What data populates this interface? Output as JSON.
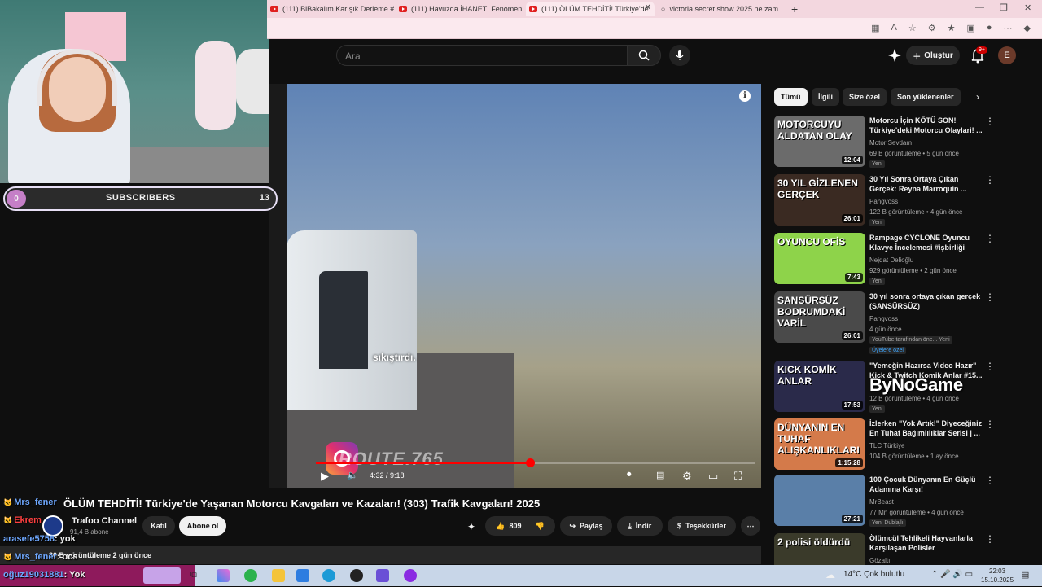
{
  "browser": {
    "tabs": [
      {
        "label": "(111) BiBakalım Karışık Derleme #"
      },
      {
        "label": "(111) Havuzda İHANET! Fenomen"
      },
      {
        "label": "(111) ÖLÜM TEHDİTİ! Türkiye'de"
      },
      {
        "label": "victoria secret show 2025 ne zam"
      }
    ]
  },
  "youtube": {
    "search_placeholder": "Ara",
    "create_label": "Oluştur",
    "notifications_count": "9+",
    "avatar_letter": "E"
  },
  "video": {
    "caption": "sıkıştırdı.",
    "watermark": "ROUTE.765",
    "time_current": "4:32",
    "time_total": "9:18",
    "time_display": "4:32 / 9:18",
    "progress_fraction": 0.487,
    "title": "ÖLÜM TEHDİTİ! Türkiye'de Yaşanan Motorcu Kavgaları ve Kazaları! (303) Trafik Kavgaları! 2025",
    "channel_name": "Trafoo Channel",
    "channel_subs": "91,4 B abone",
    "join_label": "Katıl",
    "subscribe_label": "Abone ol",
    "likes": "809",
    "share_label": "Paylaş",
    "download_label": "İndir",
    "thanks_label": "Teşekkürler",
    "views_line": "30 B görüntüleme  2 gün önce"
  },
  "chips": [
    {
      "label": "Tümü",
      "active": true
    },
    {
      "label": "İlgili"
    },
    {
      "label": "Size özel"
    },
    {
      "label": "Son yüklenenler"
    }
  ],
  "recommendations": [
    {
      "title": "Motorcu İçin KÖTÜ SON! Türkiye'deki Motorcu Olaylari! ...",
      "channel": "Motor Sevdam",
      "meta": "69 B görüntüleme • 5 gün önce",
      "badge": "Yeni",
      "duration": "12:04",
      "thumb_text": "MOTORCUYU ALDATAN OLAY",
      "color": "#6b6b6b"
    },
    {
      "title": "30 Yıl Sonra Ortaya Çıkan Gerçek: Reyna Marroquín ...",
      "channel": "Pangvoss",
      "meta": "122 B görüntüleme • 4 gün önce",
      "badge": "Yeni",
      "duration": "26:01",
      "thumb_text": "30 YIL GİZLENEN GERÇEK",
      "color": "#3a2a22"
    },
    {
      "title": "Rampage CYCLONE Oyuncu Klavye İncelemesi #işbirliği",
      "channel": "Nejdat Delioğlu",
      "meta": "929 görüntüleme • 2 gün önce",
      "badge": "Yeni",
      "duration": "7:43",
      "thumb_text": "OYUNCU OFİS",
      "color": "#8ed34a"
    },
    {
      "title": "30 yıl sonra ortaya çıkan gerçek (SANSÜRSÜZ)",
      "channel": "Pangvoss",
      "meta": "4 gün önce",
      "badge": "YouTube tarafından öne... Yeni",
      "extra": "Üyelere özel",
      "duration": "26:01",
      "thumb_text": "SANSÜRSÜZ BODRUMDAKİ VARİL",
      "color": "#4a4a4a"
    },
    {
      "title": "\"Yemeğin Hazırsa Video Hazır\" Kick & Twitch Komik Anlar #15...",
      "channel": "",
      "meta": "12 B görüntüleme • 4 gün önce",
      "badge": "Yeni",
      "duration": "17:53",
      "thumb_text": "KICK KOMİK ANLAR",
      "color": "#2a2a4a"
    },
    {
      "title": "İzlerken \"Yok Artık!\" Diyeceğiniz En Tuhaf Bağımlılıklar Serisi | ...",
      "channel": "TLC Türkiye",
      "meta": "104 B görüntüleme • 1 ay önce",
      "badge": "",
      "duration": "1:15:28",
      "thumb_text": "DÜNYANIN EN TUHAF ALIŞKANLIKLARI",
      "color": "#d47a4a"
    },
    {
      "title": "100 Çocuk Dünyanın En Güçlü Adamına Karşı!",
      "channel": "MrBeast",
      "meta": "77 Mn görüntüleme • 4 gün önce",
      "badge": "Yeni  Dublajlı",
      "duration": "27:21",
      "thumb_text": "",
      "color": "#5a7fa8"
    },
    {
      "title": "Ölümcül Tehlikeli Hayvanlarla Karşılaşan Polisler",
      "channel": "Gözaltı",
      "meta": "",
      "badge": "",
      "duration": "",
      "thumb_text": "2 polisi öldürdü",
      "color": "#3a3a2a"
    }
  ],
  "stream_overlay": {
    "subs_current": "0",
    "subs_label": "SUBSCRIBERS",
    "subs_goal": "13",
    "sponsor_logo": "ByNoGame",
    "chat": [
      {
        "user": "Mrs_fener",
        "msg": "",
        "color": "#6fa8ff"
      },
      {
        "user": "Ekrem",
        "msg": "",
        "color": "#ff4040"
      },
      {
        "user": "arasefe5758",
        "msg": ": yok",
        "color": "#6fa8ff"
      },
      {
        "user": "Mrs_fener",
        "msg": ": ocs",
        "color": "#6fa8ff"
      },
      {
        "user": "oğuz19031881",
        "msg": ": Yok",
        "color": "#6fa8ff"
      }
    ]
  },
  "taskbar": {
    "weather": "14°C  Çok bulutlu",
    "time": "22:03",
    "date": "15.10.2025"
  }
}
